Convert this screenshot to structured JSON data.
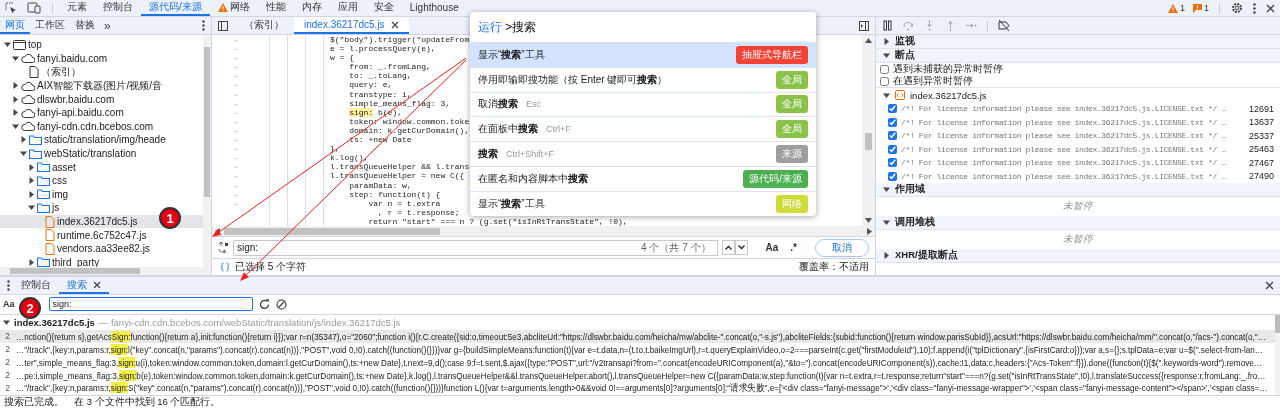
{
  "toolbar": {
    "tabs": [
      {
        "label": "元素",
        "selected": false,
        "warning": false
      },
      {
        "label": "控制台",
        "selected": false,
        "warning": false
      },
      {
        "label": "源代码/来源",
        "selected": true,
        "warning": false
      },
      {
        "label": "网络",
        "selected": false,
        "warning": true
      },
      {
        "label": "性能",
        "selected": false,
        "warning": false
      },
      {
        "label": "内存",
        "selected": false,
        "warning": false
      },
      {
        "label": "应用",
        "selected": false,
        "warning": false
      },
      {
        "label": "安全",
        "selected": false,
        "warning": false
      },
      {
        "label": "Lighthouse",
        "selected": false,
        "warning": false
      }
    ],
    "warnings_count": "1",
    "issues_count": "1"
  },
  "navigator": {
    "tabs": [
      {
        "label": "网页",
        "selected": true
      },
      {
        "label": "工作区",
        "selected": false
      },
      {
        "label": "替换",
        "selected": false
      }
    ],
    "more_tabs": "»",
    "tree": [
      {
        "label": "top",
        "kind": "frame",
        "expanded": true,
        "selected": false,
        "children": [
          {
            "label": "fanyi.baidu.com",
            "kind": "domain",
            "expanded": true,
            "selected": false,
            "children": [
              {
                "label": "（索引）",
                "kind": "document",
                "selected": false
              }
            ]
          },
          {
            "label": "AIX智能下载器(图片/视频/音",
            "kind": "domain",
            "expanded": false,
            "selected": false
          },
          {
            "label": "dlswbr.baidu.com",
            "kind": "domain",
            "expanded": false,
            "selected": false
          },
          {
            "label": "fanyi-api.baidu.com",
            "kind": "domain",
            "expanded": false,
            "selected": false
          },
          {
            "label": "fanyi-cdn.cdn.bcebos.com",
            "kind": "domain",
            "expanded": true,
            "selected": false,
            "children": [
              {
                "label": "static/translation/img/heade",
                "kind": "folder",
                "expanded": false,
                "selected": false
              },
              {
                "label": "webStatic/translation",
                "kind": "folder",
                "expanded": true,
                "selected": false,
                "children": [
                  {
                    "label": "asset",
                    "kind": "folder",
                    "expanded": false,
                    "selected": false
                  },
                  {
                    "label": "css",
                    "kind": "folder",
                    "expanded": false,
                    "selected": false
                  },
                  {
                    "label": "img",
                    "kind": "folder",
                    "expanded": false,
                    "selected": false
                  },
                  {
                    "label": "js",
                    "kind": "folder",
                    "expanded": true,
                    "selected": false,
                    "children": [
                      {
                        "label": "index.36217dc5.js",
                        "kind": "script",
                        "selected": true
                      },
                      {
                        "label": "runtime.6c752c47.js",
                        "kind": "script",
                        "selected": false
                      },
                      {
                        "label": "vendors.aa33ee82.js",
                        "kind": "script",
                        "selected": false
                      }
                    ]
                  },
                  {
                    "label": "third_party",
                    "kind": "folder",
                    "expanded": false,
                    "selected": false
                  }
                ]
              }
            ]
          }
        ]
      }
    ]
  },
  "editor": {
    "tabs": [
      {
        "label": "（索引）",
        "selected": false
      },
      {
        "label": "index.36217dc5.js",
        "selected": true
      }
    ],
    "code_lines": [
      {
        "gutter": "-",
        "text": "$(\"body\").trigger(\"updateFrom"
      },
      {
        "gutter": "-",
        "text": "e = l.processQuery(e),"
      },
      {
        "gutter": "-",
        "text": "w = {",
        "children": [
          {
            "gutter": "-",
            "text": "from: _.fromLang,"
          },
          {
            "gutter": "-",
            "text": "to: _.toLang,"
          },
          {
            "gutter": "-",
            "text": "query: e,"
          },
          {
            "gutter": "-",
            "text": "transtype: i,"
          },
          {
            "gutter": "-",
            "text": "simple_means_flag: 3,"
          },
          {
            "gutter": "-",
            "match": "sign:",
            "after": " b(e),"
          },
          {
            "gutter": "-",
            "text": "token: window.common.toke"
          },
          {
            "gutter": "-",
            "text": "domain: k.getCurDomain(),"
          },
          {
            "gutter": "-",
            "text": "ts: +new Date"
          }
        ]
      },
      {
        "gutter": "-",
        "text": "},"
      },
      {
        "gutter": "-",
        "text": "k.log(),"
      },
      {
        "gutter": "-",
        "text": "l.transQueueHelper && l.trans"
      },
      {
        "gutter": "-",
        "text": "l.transQueueHelper = new C({",
        "children": [
          {
            "gutter": "-",
            "text": "paramData: w,"
          },
          {
            "gutter": "-",
            "text": "step: function(t) {",
            "children": [
              {
                "gutter": "-",
                "text": "var n = t.extra"
              },
              {
                "text": "  , r = t.response;"
              },
              {
                "text": "return \"start\" === n ? (g.set(\"isInRtTransState\", !0),"
              }
            ]
          }
        ]
      }
    ],
    "search_bar": {
      "value": "sign:",
      "match_count": "4 个（共 7 个）",
      "case_label": "Aa",
      "regex_label": ".*",
      "cancel": "取消"
    },
    "status_bar": {
      "selection": "已选择 5 个字符",
      "coverage": "覆盖率：不适用"
    }
  },
  "command_palette": {
    "prompt": "运行",
    "query": ">搜索",
    "commands": [
      {
        "label": "显示“**搜索**”工具",
        "badge": "抽屉式导航栏",
        "color": "#f44336",
        "selected": true
      },
      {
        "label": "停用即输即搜功能（按 Enter 键即可**搜索**）",
        "badge": "全局",
        "color": "#8bc34a",
        "selected": false
      },
      {
        "label": "取消**搜索**",
        "shortcut": "Esc",
        "badge": "全局",
        "color": "#8bc34a",
        "selected": false
      },
      {
        "label": "在面板中**搜索**",
        "shortcut": "Ctrl+F",
        "badge": "全局",
        "color": "#8bc34a",
        "selected": false
      },
      {
        "label": "**搜索**",
        "shortcut": "Ctrl+Shift+F",
        "badge": "来源",
        "color": "#9e9e9e",
        "selected": false
      },
      {
        "label": "在匿名和内容脚本中**搜索**",
        "badge": "源代码/来源",
        "color": "#4caf50",
        "selected": false
      },
      {
        "label": "显示“**搜索**”工具",
        "badge": "网络",
        "color": "#cddc39",
        "selected": false
      }
    ]
  },
  "debugger": {
    "sections": [
      {
        "title": "监视",
        "expanded": false
      },
      {
        "title": "断点",
        "kind": "breakpoints",
        "expanded": true,
        "exceptions": [
          {
            "label": "遇到未捕获的异常时暂停",
            "checked": false
          },
          {
            "label": "在遇到异常时暂停",
            "checked": false
          }
        ],
        "files": [
          {
            "name": "index.36217dc5.js",
            "expanded": true,
            "breakpoints": [
              {
                "code": "/*! For license information please see index.36217dc5.js.LICENSE.txt */ …",
                "line": "12691",
                "checked": true
              },
              {
                "code": "/*! For license information please see index.36217dc5.js.LICENSE.txt */ …",
                "line": "13637",
                "checked": true
              },
              {
                "code": "/*! For license information please see index.36217dc5.js.LICENSE.txt */ …",
                "line": "25337",
                "checked": true
              },
              {
                "code": "/*! For license information please see index.36217dc5.js.LICENSE.txt */ …",
                "line": "25463",
                "checked": true
              },
              {
                "code": "/*! For license information please see index.36217dc5.js.LICENSE.txt */ …",
                "line": "27467",
                "checked": true
              },
              {
                "code": "/*! For license information please see index.36217dc5.js.LICENSE.txt */ …",
                "line": "27490",
                "checked": true
              }
            ]
          }
        ]
      },
      {
        "title": "作用域",
        "kind": "message",
        "expanded": true,
        "message": "未暂停"
      },
      {
        "title": "调用堆栈",
        "kind": "message",
        "expanded": true,
        "message": "未暂停"
      },
      {
        "title": "XHR/提取断点",
        "expanded": false
      }
    ]
  },
  "drawer": {
    "tabs": [
      {
        "label": "控制台",
        "selected": false
      },
      {
        "label": "搜索",
        "selected": true
      }
    ],
    "search": {
      "case_label": "Aa",
      "value": "sign:"
    },
    "results": {
      "file": "index.36217dc5.js",
      "path": "— fanyi-cdn.cdn.bcebos.com/webStatic/translation/js/index.36217dc5.js",
      "expanded": true,
      "lines": [
        {
          "line": "2",
          "before": "…nction(){return s},getAcs",
          "match": "Sign:",
          "after": "function(){return a},init:function(){return i}});var r=n(35347),o=\"2060\";function i(){r.C.create({sid:o,timeout:5e3,abcliteUrl:\"https://dlswbr.baidu.com/heicha/mw/abclite-\".concat(o,\"-s.js\"),abcliteFields:{subid:function(){return window.parisSubId}},acsUrl:\"https://dlswbr.baidu.com/heicha/mm/\".concat(o,\"/acs-\").concat(o,\"…",
          "selected": true
        },
        {
          "line": "2",
          "before": "…\"/track\",{key:n,params:r,",
          "match": "sign:",
          "after": "l(\"key\".concat(n,\"params\").concat(r).concat(n))},\"POST\",void 0,!0).catch((function(){}))}var g={buildSimpleMeans:function(t){var e=t.data,n=(t.to,t.baikeImgUrl),r=t.queryExplainVideo,o=2===parseInt(c.get(\"firstModuleId\"),10);f.append(i(\"tplDictionary\",{isFirstCard:o}));var a,s={};s.tplData=e;var u=$(\".select-from-lan…",
          "selected": false
        },
        {
          "line": "2",
          "before": "…ter\",simple_means_flag:3,",
          "match": "sign:",
          "after": "u(i),token:window.common.token,domain:l.getCurDomain(),ts:+new Date},t.next=9,d();case 9:f=t.sent,$.ajax({type:\"POST\",url:\"/v2transapi?from=\".concat(encodeURIComponent(a),\"&to=\").concat(encodeURIComponent(s)),cache:!1,data:c,headers:{\"Acs-Token\":f}}).done((function(t){$(\".keywords-word\").remove…",
          "selected": false
        },
        {
          "line": "2",
          "before": "…pe:i,simple_means_flag:3,",
          "match": "sign:",
          "after": "b(e),token:window.common.token,domain:k.getCurDomain(),ts:+new Date},k.log(),l.transQueueHelper&&l.transQueueHelper.abort(),l.transQueueHelper=new C({paramData:w,step:function(t){var n=t.extra,r=t.response;return\"start\"===n?(g.set(\"isInRtTransState\",!0),l.translateSuccess({response:r,fromLang:_.fro…",
          "selected": false
        },
        {
          "line": "2",
          "before": "…\"/track\",{key:n,params:r,",
          "match": "sign:",
          "after": "S(\"key\".concat(n,\"params\").concat(r).concat(n))},\"POST\",void 0,!0).catch((function(){}))}function L(){var t=arguments.length>0&&void 0!==arguments[0]?arguments[0]:\"请求失败\",e=['<div class=\"fanyi-message\">','<div class=\"fanyi-message-wrapper\">','<span class=\"fanyi-message-content\"></span>','<span class=…",
          "selected": false
        }
      ]
    },
    "status": "搜索已完成。",
    "summary": "在 3 个文件中找到 16 个匹配行。"
  },
  "annotations": [
    {
      "label": "1"
    },
    {
      "label": "2"
    }
  ]
}
